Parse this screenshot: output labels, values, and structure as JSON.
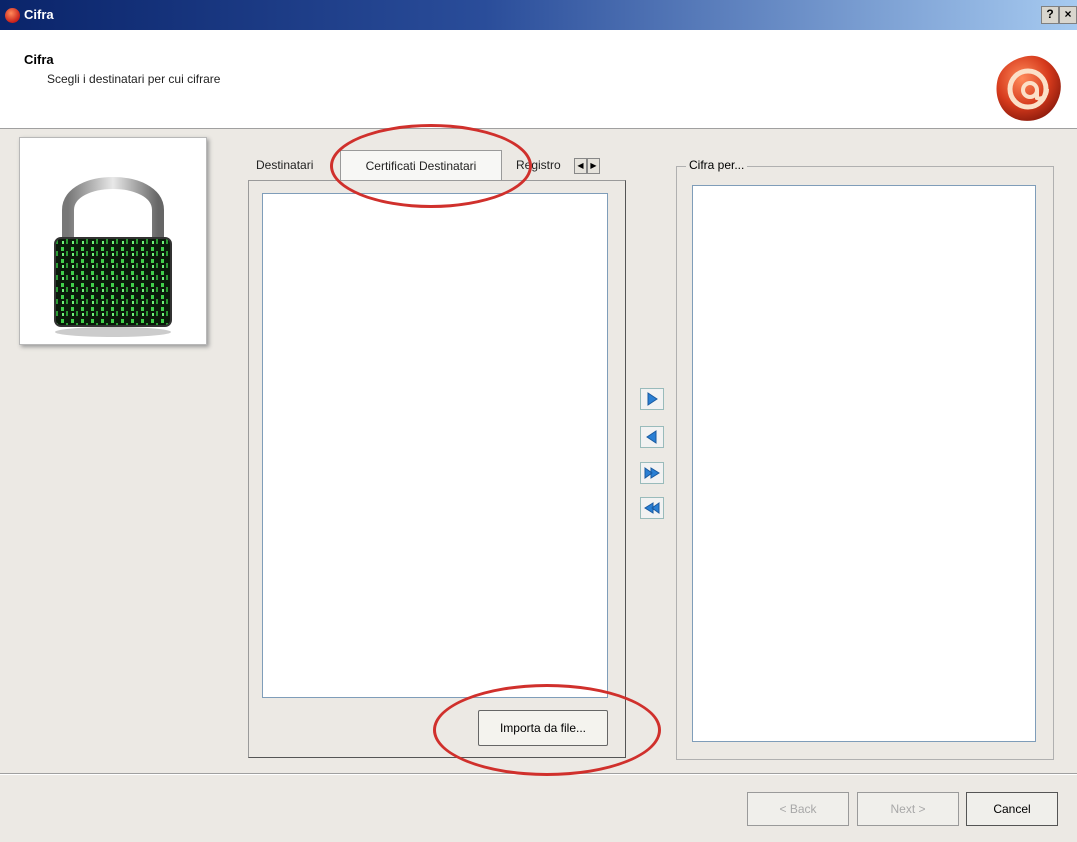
{
  "window": {
    "title": "Cifra",
    "help_label": "?",
    "close_label": "×"
  },
  "header": {
    "title": "Cifra",
    "subtitle": "Scegli i destinatari per cui cifrare"
  },
  "tabs": [
    {
      "label": "Destinatari",
      "active": false
    },
    {
      "label": "Certificati Destinatari",
      "active": true
    },
    {
      "label": "Registro",
      "active": false
    }
  ],
  "left_panel": {
    "import_button": "Importa da file..."
  },
  "right_panel": {
    "group_label": "Cifra per..."
  },
  "footer": {
    "back_label": "< Back",
    "next_label": "Next >",
    "cancel_label": "Cancel"
  },
  "colors": {
    "title_gradient_start": "#0a246a",
    "arrow_blue": "#2a7fd4",
    "highlight_red": "#d0302c"
  }
}
